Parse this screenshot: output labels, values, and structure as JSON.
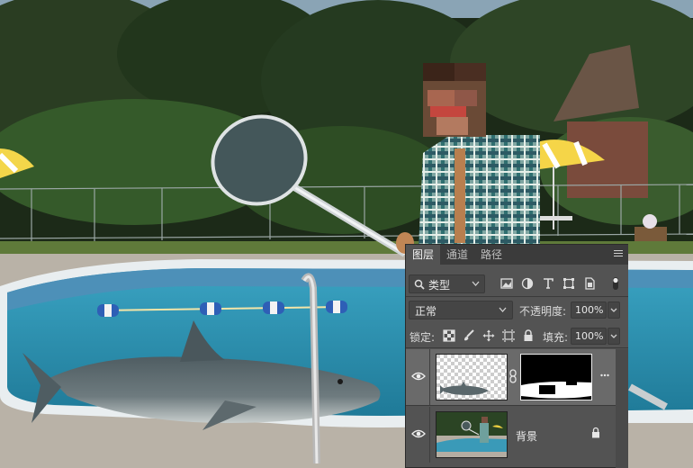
{
  "panel": {
    "tabs": [
      "图层",
      "通道",
      "路径"
    ],
    "active_tab": "图层",
    "filter_label": "类型",
    "blend_mode": "正常",
    "opacity_label": "不透明度:",
    "opacity_value": "100%",
    "lock_label": "锁定:",
    "fill_label": "填充:",
    "fill_value": "100%"
  },
  "layers": [
    {
      "name": "",
      "visible": true,
      "has_mask": true,
      "selected": true
    },
    {
      "name": "背景",
      "visible": true,
      "locked": true
    }
  ],
  "icons": {
    "filter": "search-icon",
    "filter_kinds": [
      "image-filter-icon",
      "adjustment-filter-icon",
      "type-filter-icon",
      "shape-filter-icon",
      "smart-object-filter-icon",
      "toggle-filter-icon"
    ],
    "locks": [
      "lock-transparency-icon",
      "lock-paint-icon",
      "lock-position-icon",
      "lock-artboard-icon",
      "lock-all-icon"
    ]
  },
  "colors": {
    "panel_bg": "#535353",
    "panel_tab_bar": "#3b3b3b",
    "selected_layer": "#6a6a6a",
    "water": "#2f8fae"
  }
}
